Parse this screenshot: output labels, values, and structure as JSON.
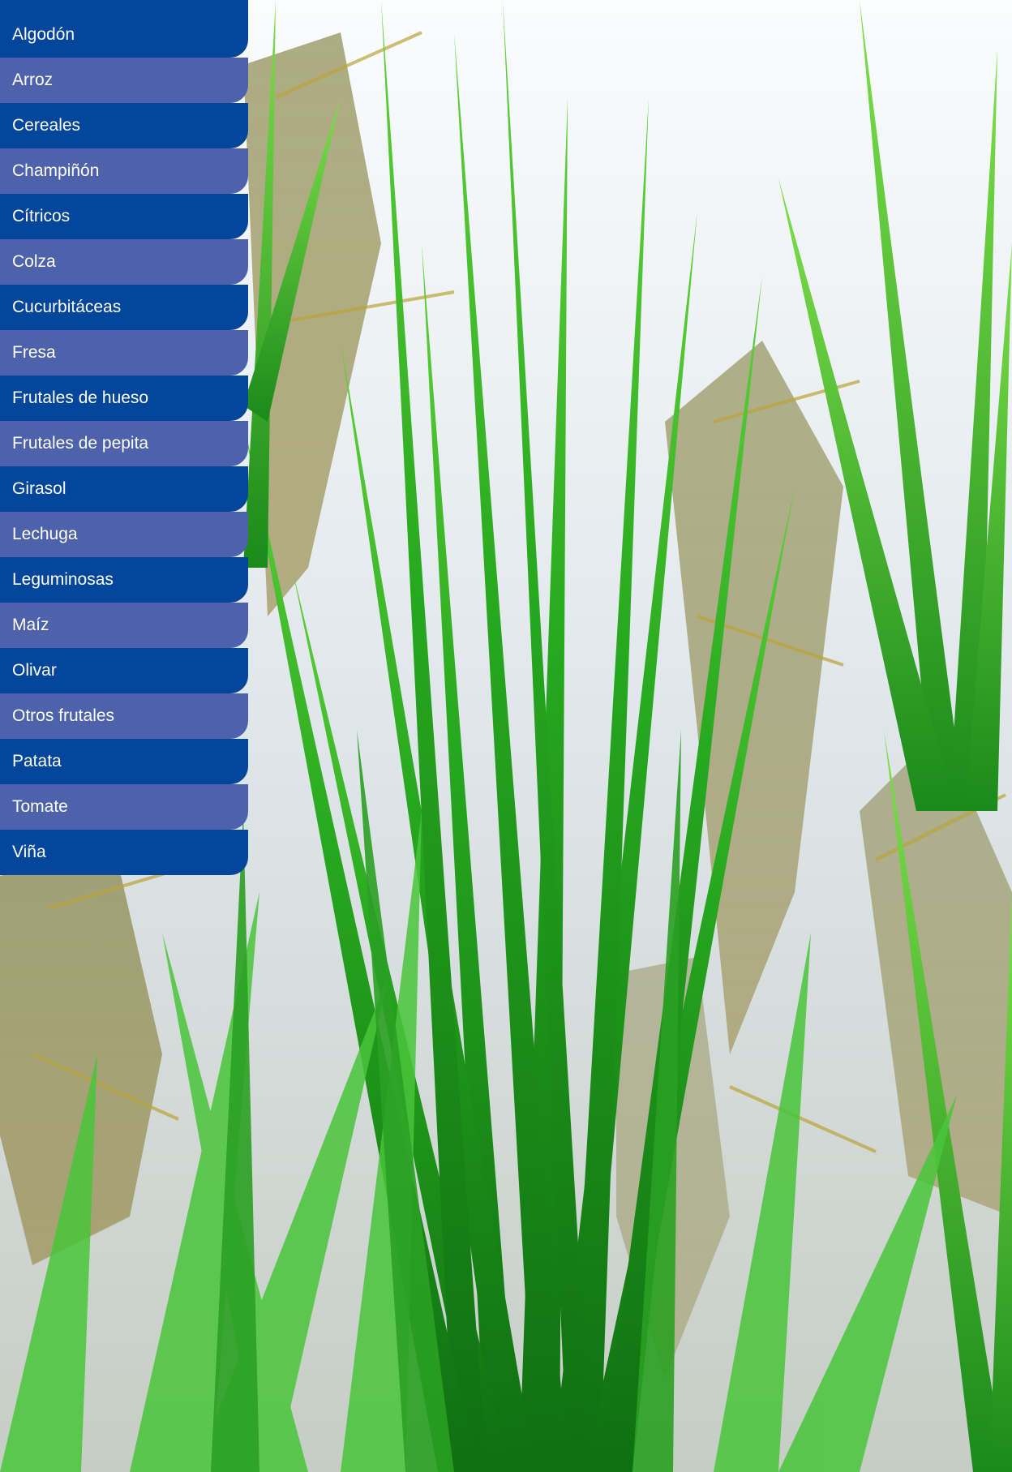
{
  "menu": {
    "items": [
      {
        "label": "Algodón"
      },
      {
        "label": "Arroz"
      },
      {
        "label": "Cereales"
      },
      {
        "label": "Champiñón"
      },
      {
        "label": "Cítricos"
      },
      {
        "label": "Colza"
      },
      {
        "label": "Cucurbitáceas"
      },
      {
        "label": "Fresa"
      },
      {
        "label": "Frutales de hueso"
      },
      {
        "label": "Frutales de pepita"
      },
      {
        "label": "Girasol"
      },
      {
        "label": "Lechuga"
      },
      {
        "label": "Leguminosas"
      },
      {
        "label": "Maíz"
      },
      {
        "label": "Olivar"
      },
      {
        "label": "Otros frutales"
      },
      {
        "label": "Patata"
      },
      {
        "label": "Tomate"
      },
      {
        "label": "Viña"
      }
    ]
  },
  "colors": {
    "menu_dark": "#03469b",
    "menu_light": "#4d62aa",
    "menu_text": "#ffffff",
    "leaf_green": "#2fb52a",
    "water": "#e6ecef"
  },
  "background": {
    "subject": "rice-plants-in-flooded-paddy"
  }
}
